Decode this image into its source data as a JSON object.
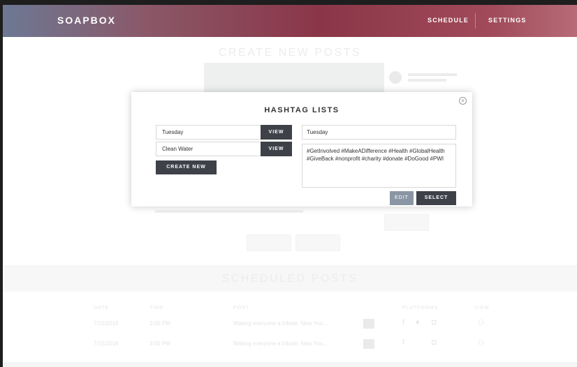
{
  "header": {
    "logo": "SOAPBOX",
    "nav": {
      "schedule": "SCHEDULE",
      "settings": "SETTINGS"
    }
  },
  "background": {
    "create_title": "CREATE NEW POSTS",
    "scheduled_title": "SCHEDULED POSTS",
    "table_headers": {
      "date": "DATE",
      "time": "TIME",
      "post": "POST",
      "platforms": "PLATFORMS",
      "view": "VIEW"
    },
    "rows": [
      {
        "date": "7/15/2016",
        "time": "3:00 PM",
        "post": "Making everyone a tribute. New You..."
      },
      {
        "date": "7/15/2016",
        "time": "3:00 PM",
        "post": "Making everyone a tribute. New You..."
      }
    ]
  },
  "modal": {
    "title": "HASHTAG LISTS",
    "lists": [
      {
        "name": "Tuesday",
        "view_label": "VIEW"
      },
      {
        "name": "Clean Water",
        "view_label": "VIEW"
      }
    ],
    "create_label": "CREATE NEW",
    "selected_name": "Tuesday",
    "hashtags": "#GetInvolved  #MakeADifference  #Health  #GlobalHealth  #GiveBack  #nonprofit  #charity  #donate  #DoGood  #PWI",
    "edit_label": "EDIT",
    "select_label": "SELECT",
    "close_symbol": "×"
  }
}
